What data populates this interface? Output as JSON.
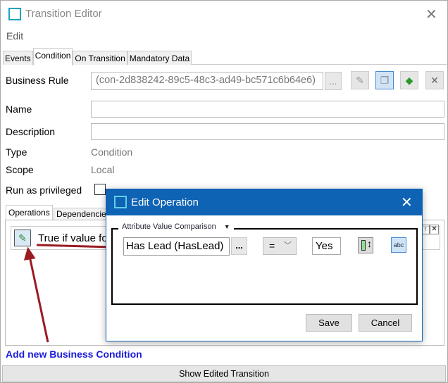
{
  "window": {
    "title": "Transition Editor",
    "menu": [
      "Edit"
    ]
  },
  "tabs": [
    "Events",
    "Condition",
    "On Transition",
    "Mandatory Data"
  ],
  "active_tab": "Condition",
  "form": {
    "business_rule_label": "Business Rule",
    "business_rule_value": "(con-2d838242-89c5-48c3-ad49-bc571c6b64e6)",
    "browse": "...",
    "name_label": "Name",
    "name_value": "",
    "description_label": "Description",
    "description_value": "",
    "type_label": "Type",
    "type_value": "Condition",
    "scope_label": "Scope",
    "scope_value": "Local",
    "privileged_label": "Run as privileged",
    "privileged_checked": false
  },
  "subtabs": [
    "Operations",
    "Dependencies"
  ],
  "operation": {
    "text": "True if value fo"
  },
  "add_link": "Add new Business Condition",
  "bottom_button": "Show Edited Transition",
  "dialog": {
    "title": "Edit Operation",
    "group": "Attribute Value Comparison",
    "attribute": "Has Lead (HasLead)",
    "browse": "...",
    "operator": "=",
    "value": "Yes",
    "abc": "abc",
    "save": "Save",
    "cancel": "Cancel"
  },
  "colors": {
    "dialog_title": "#0e63b4",
    "link": "#1a1adc",
    "arrow": "#9b1b22"
  }
}
